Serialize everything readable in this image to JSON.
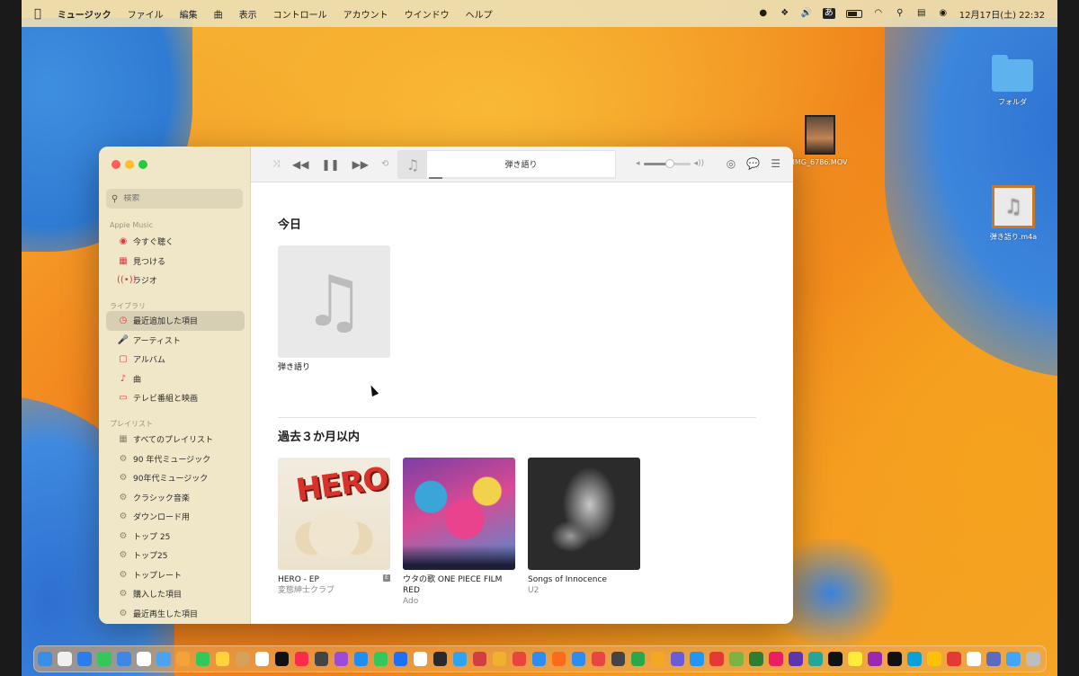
{
  "menubar": {
    "app_name": "ミュージック",
    "items": [
      "ファイル",
      "編集",
      "曲",
      "表示",
      "コントロール",
      "アカウント",
      "ウインドウ",
      "ヘルプ"
    ],
    "ime_label": "あ",
    "clock": "12月17日(土)  22:32"
  },
  "desktop": {
    "folder_label": "フォルダ",
    "movie_label": "IMG_6786.MOV",
    "m4a_label": "弾き語り.m4a"
  },
  "sidebar": {
    "search_placeholder": "検索",
    "sections": {
      "apple_music": "Apple Music",
      "library": "ライブラリ",
      "playlists": "プレイリスト"
    },
    "apple_music_items": [
      {
        "label": "今すぐ聴く",
        "icon": "play-circle-icon"
      },
      {
        "label": "見つける",
        "icon": "grid-icon"
      },
      {
        "label": "ラジオ",
        "icon": "radio-icon"
      }
    ],
    "library_items": [
      {
        "label": "最近追加した項目",
        "icon": "clock-icon",
        "active": true
      },
      {
        "label": "アーティスト",
        "icon": "microphone-icon"
      },
      {
        "label": "アルバム",
        "icon": "album-icon"
      },
      {
        "label": "曲",
        "icon": "music-note-icon"
      },
      {
        "label": "テレビ番組と映画",
        "icon": "tv-icon"
      }
    ],
    "playlist_items": [
      {
        "label": "すべてのプレイリスト",
        "icon": "grid-icon"
      },
      {
        "label": "90 年代ミュージック",
        "icon": "gear-icon"
      },
      {
        "label": "90年代ミュージック",
        "icon": "gear-icon"
      },
      {
        "label": "クラシック音楽",
        "icon": "gear-icon"
      },
      {
        "label": "ダウンロード用",
        "icon": "gear-icon"
      },
      {
        "label": "トップ 25",
        "icon": "gear-icon"
      },
      {
        "label": "トップ25",
        "icon": "gear-icon"
      },
      {
        "label": "トップレート",
        "icon": "gear-icon"
      },
      {
        "label": "購入した項目",
        "icon": "gear-icon"
      },
      {
        "label": "最近再生した項目",
        "icon": "gear-icon"
      }
    ]
  },
  "player": {
    "now_playing_title": "弾き語り",
    "progress_fraction": 0.07,
    "volume_fraction": 0.55
  },
  "content": {
    "today_title": "今日",
    "today_albums": [
      {
        "name": "弾き語り",
        "artist": ""
      }
    ],
    "recent_title": "過去３か月以内",
    "recent_albums": [
      {
        "name": "HERO - EP",
        "artist": "変態紳士クラブ",
        "explicit": true
      },
      {
        "name": "ウタの歌 ONE PIECE FILM RED",
        "artist": "Ado"
      },
      {
        "name": "Songs of Innocence",
        "artist": "U2"
      }
    ],
    "hero_cover_text": "HERO",
    "explicit_badge": "E"
  },
  "colors": {
    "accent_red": "#e8343c",
    "sidebar_bg": "#f0e6c6",
    "toolbar_bg": "#f3f2f2"
  },
  "dock": {
    "app_colors": [
      "#3c8de8",
      "#f0f0f0",
      "#2b7de9",
      "#34c759",
      "#3d87e6",
      "#ffffff",
      "#4aa3f0",
      "#f2a33a",
      "#34c759",
      "#ffd23f",
      "#d6a15a",
      "#ffffff",
      "#111111",
      "#fa2d48",
      "#444444",
      "#9c4bd6",
      "#1f8ef1",
      "#34c759",
      "#1e6ff2",
      "#ffffff",
      "#2a2a2a",
      "#2ea3f2",
      "#d04040",
      "#f0b030",
      "#e8453c",
      "#2d8cf0",
      "#fb6b1a",
      "#2d8cf0",
      "#e84545",
      "#444444",
      "#2aa84a",
      "#f5a623",
      "#6a5cd6",
      "#2196f3",
      "#e53935",
      "#7cb342",
      "#2e7d32",
      "#e91e63",
      "#5e35b1",
      "#26a69a",
      "#111111",
      "#ffeb3b",
      "#9c27b0",
      "#111111",
      "#0aa0d8",
      "#ffc107",
      "#e53935",
      "#ffffff",
      "#5c6bc0",
      "#42a5f5",
      "#bdbdbd"
    ]
  }
}
